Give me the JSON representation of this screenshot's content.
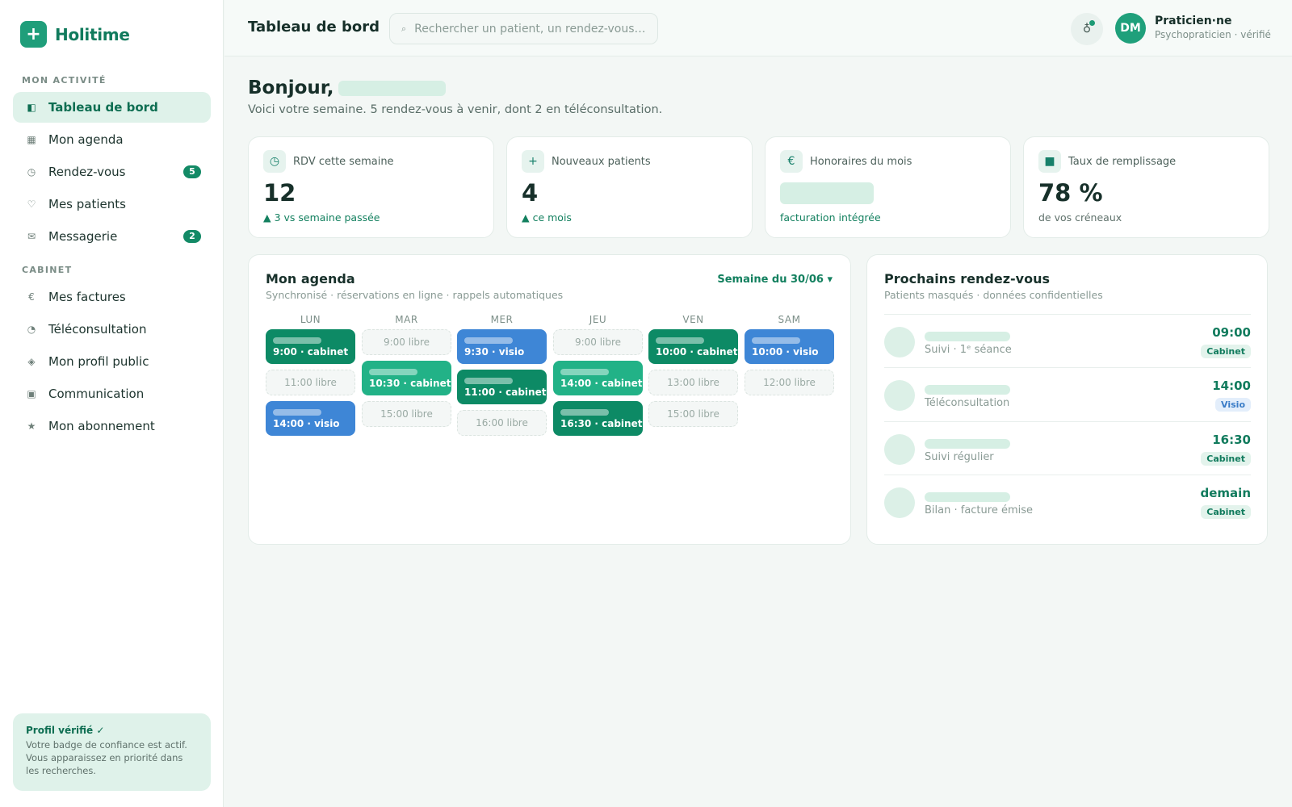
{
  "app": {
    "name": "Holitime"
  },
  "sidebar": {
    "sections": [
      "MON ACTIVITÉ",
      "CABINET"
    ],
    "items": [
      {
        "label": "Tableau de bord",
        "icon": "◧"
      },
      {
        "label": "Mon agenda",
        "icon": "▦"
      },
      {
        "label": "Rendez-vous",
        "icon": "◷",
        "badge": "5"
      },
      {
        "label": "Mes patients",
        "icon": "♡"
      },
      {
        "label": "Messagerie",
        "icon": "✉",
        "badge": "2"
      },
      {
        "label": "Mes factures",
        "icon": "€"
      },
      {
        "label": "Téléconsultation",
        "icon": "◔"
      },
      {
        "label": "Mon profil public",
        "icon": "◈"
      },
      {
        "label": "Communication",
        "icon": "▣"
      },
      {
        "label": "Mon abonnement",
        "icon": "★"
      }
    ],
    "verified_card": {
      "title": "Profil vérifié ✓",
      "text": "Votre badge de confiance est actif. Vous apparaissez en priorité dans les recherches."
    }
  },
  "header": {
    "title": "Tableau de bord",
    "search_placeholder": "Rechercher un patient, un rendez-vous…",
    "user_initials": "DM",
    "user_name": "Praticien·ne",
    "user_role": "Psychopraticien · vérifié"
  },
  "greeting": {
    "hello": "Bonjour,",
    "subtitle": "Voici votre semaine. 5 rendez-vous à venir, dont 2 en téléconsultation."
  },
  "stats": [
    {
      "label": "RDV cette semaine",
      "icon": "◷",
      "value": "12",
      "trend": "▲ 3 vs semaine passée"
    },
    {
      "label": "Nouveaux patients",
      "icon": "+",
      "value": "4",
      "trend": "▲ ce mois"
    },
    {
      "label": "Honoraires du mois",
      "icon": "€",
      "value": "",
      "trend": "facturation intégrée"
    },
    {
      "label": "Taux de remplissage",
      "icon": "■",
      "value": "78 %",
      "trend": "de vos créneaux"
    }
  ],
  "agenda": {
    "title": "Mon agenda",
    "subtitle": "Synchronisé · réservations en ligne · rappels automatiques",
    "week_selector": "Semaine du 30/06 ▾",
    "days": [
      {
        "label": "LUN",
        "slots": [
          {
            "text": "9:00 · cabinet",
            "kind": "cab-dark"
          },
          {
            "text": "11:00 libre",
            "kind": "free"
          },
          {
            "text": "14:00 · visio",
            "kind": "visio"
          }
        ]
      },
      {
        "label": "MAR",
        "slots": [
          {
            "text": "9:00 libre",
            "kind": "free"
          },
          {
            "text": "10:30 · cabinet",
            "kind": "cab-light"
          },
          {
            "text": "15:00 libre",
            "kind": "free"
          }
        ]
      },
      {
        "label": "MER",
        "slots": [
          {
            "text": "9:30 · visio",
            "kind": "visio"
          },
          {
            "text": "11:00 · cabinet",
            "kind": "cab-dark"
          },
          {
            "text": "16:00 libre",
            "kind": "free"
          }
        ]
      },
      {
        "label": "JEU",
        "slots": [
          {
            "text": "9:00 libre",
            "kind": "free"
          },
          {
            "text": "14:00 · cabinet",
            "kind": "cab-light"
          },
          {
            "text": "16:30 · cabinet",
            "kind": "cab-dark"
          }
        ]
      },
      {
        "label": "VEN",
        "slots": [
          {
            "text": "10:00 · cabinet",
            "kind": "cab-dark"
          },
          {
            "text": "13:00 libre",
            "kind": "free"
          },
          {
            "text": "15:00 libre",
            "kind": "free"
          }
        ]
      },
      {
        "label": "SAM",
        "slots": [
          {
            "text": "10:00 · visio",
            "kind": "visio"
          },
          {
            "text": "12:00 libre",
            "kind": "free"
          }
        ]
      }
    ]
  },
  "upcoming": {
    "title": "Prochains rendez-vous",
    "subtitle": "Patients masqués · données confidentielles",
    "items": [
      {
        "label": "Suivi · 1ᵉ séance",
        "time": "09:00",
        "tag": "Cabinet",
        "tag_kind": "cabinet"
      },
      {
        "label": "Téléconsultation",
        "time": "14:00",
        "tag": "Visio",
        "tag_kind": "visio"
      },
      {
        "label": "Suivi régulier",
        "time": "16:30",
        "tag": "Cabinet",
        "tag_kind": "cabinet"
      },
      {
        "label": "Bilan · facture émise",
        "time": "demain",
        "tag": "Cabinet",
        "tag_kind": "cabinet"
      }
    ]
  },
  "colors": {
    "brand": "#1f9e7a",
    "cabinet_dark": "#0d8a65",
    "cabinet_light": "#22b287",
    "visio": "#3e86d6"
  }
}
